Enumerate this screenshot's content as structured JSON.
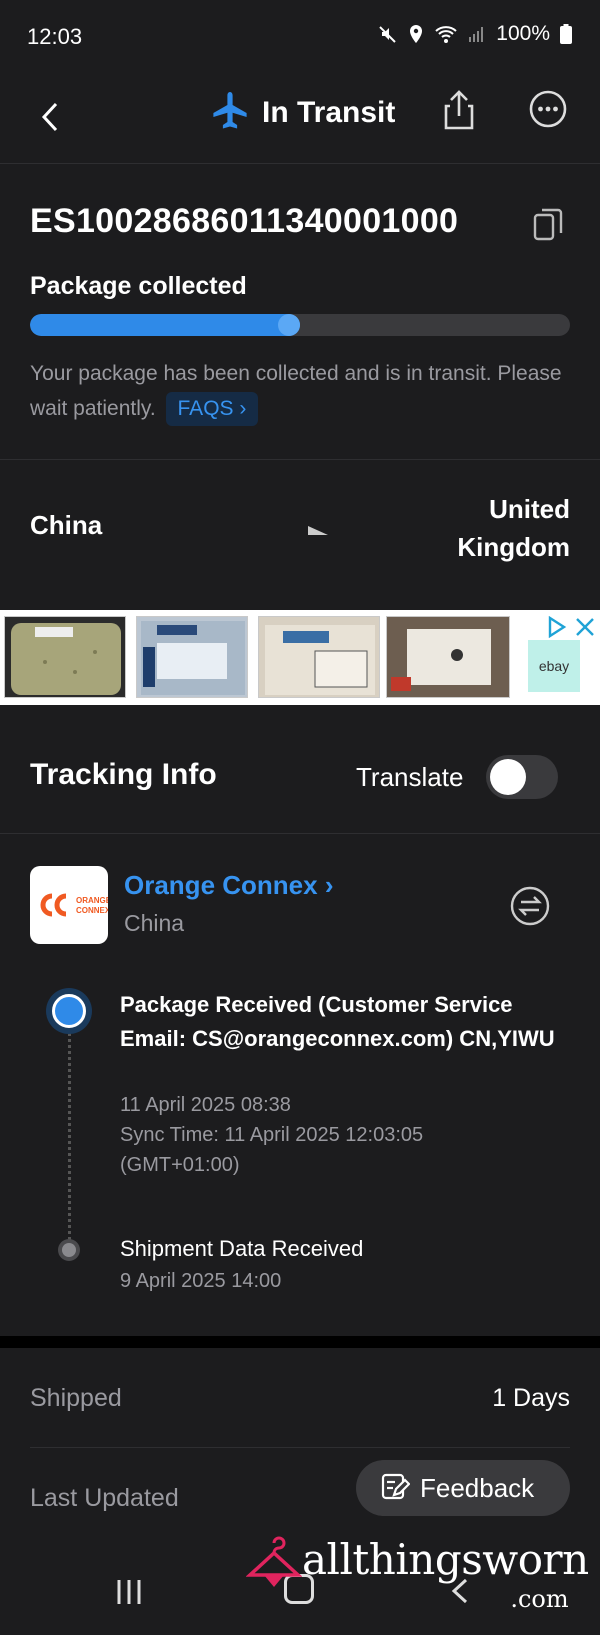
{
  "status_bar": {
    "time": "12:03",
    "battery": "100%"
  },
  "header": {
    "title": "In Transit",
    "icons": [
      "back-arrow-icon",
      "airplane-icon",
      "share-icon",
      "more-icon"
    ]
  },
  "summary": {
    "tracking_number": "ES10028686011340001000",
    "status_title": "Package collected",
    "progress_fraction": 0.5,
    "description": "Your package has been collected and is in transit. Please wait patiently.",
    "faq_label": "FAQS"
  },
  "route": {
    "origin": "China",
    "destination_line1": "United",
    "destination_line2": "Kingdom"
  },
  "ad": {
    "ebay_label": "ebay"
  },
  "tracking_info": {
    "title": "Tracking Info",
    "translate_label": "Translate",
    "translate_on": false,
    "carrier": {
      "name": "Orange Connex",
      "country": "China",
      "logo_line1": "ORANGE",
      "logo_line2": "CONNEX"
    },
    "events": [
      {
        "title": "Package Received (Customer Service Email: CS@orangeconnex.com) CN,YIWU",
        "datetime": "11 April 2025 08:38",
        "sync": "Sync Time: 11 April 2025 12:03:05",
        "tz": "(GMT+01:00)"
      },
      {
        "title": "Shipment Data Received",
        "datetime": "9 April 2025 14:00"
      }
    ]
  },
  "meta": {
    "shipped_label": "Shipped",
    "shipped_value": "1 Days",
    "updated_label": "Last Updated"
  },
  "feedback": {
    "label": "Feedback"
  },
  "watermark": {
    "main": "allthingsworn",
    "suffix": ".com"
  },
  "colors": {
    "accent": "#2f8ae8",
    "background": "#1c1c1e"
  }
}
